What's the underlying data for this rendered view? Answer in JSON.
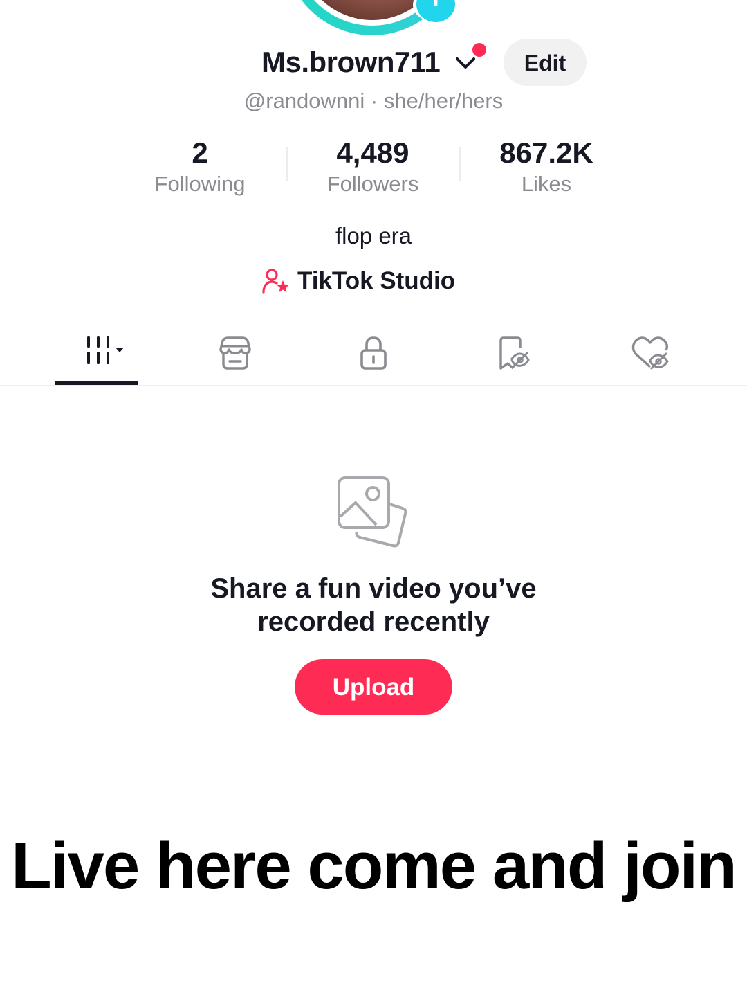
{
  "profile": {
    "display_name": "Ms.brown711",
    "username": "@randownni",
    "separator": "·",
    "pronouns": "she/her/hers",
    "edit_label": "Edit",
    "bio": "flop era",
    "studio_label": "TikTok Studio",
    "avatar_add_icon": "plus-icon"
  },
  "stats": [
    {
      "value": "2",
      "label": "Following"
    },
    {
      "value": "4,489",
      "label": "Followers"
    },
    {
      "value": "867.2K",
      "label": "Likes"
    }
  ],
  "tabs": [
    {
      "icon": "videos-grid-icon",
      "active": true
    },
    {
      "icon": "shop-icon",
      "active": false
    },
    {
      "icon": "lock-icon",
      "active": false
    },
    {
      "icon": "hidden-favorites-icon",
      "active": false
    },
    {
      "icon": "hidden-liked-icon",
      "active": false
    }
  ],
  "empty_state": {
    "icon": "photos-icon",
    "title_line1": "Share a fun video you’ve",
    "title_line2": "recorded recently",
    "upload_label": "Upload"
  },
  "overlay_caption": "Live here come and join",
  "colors": {
    "accent": "#fe2c55",
    "avatar_ring": "#25d6c8",
    "add_badge": "#20d5ec",
    "secondary_text": "#8a8b91",
    "primary_text": "#161823"
  }
}
